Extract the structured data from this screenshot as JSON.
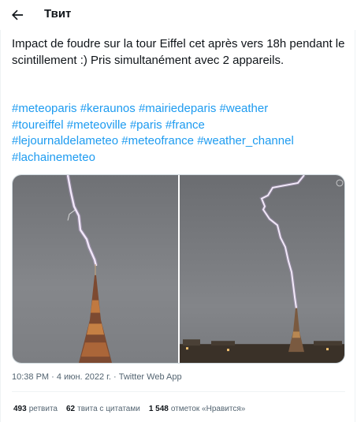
{
  "header": {
    "title": "Твит",
    "back_icon": "arrow-left-icon"
  },
  "tweet": {
    "text": "Impact de foudre sur la tour Eiffel cet après vers 18h pendant le scintillement :) Pris simultanément avec 2 appareils.",
    "hashtags": [
      "#meteoparis",
      "#keraunos",
      "#mairiedeparis",
      "#weather",
      "#toureiffel",
      "#meteoville",
      "#paris",
      "#france",
      "#lejournaldelameteo",
      "#meteofrance",
      "#weather_channel",
      "#lachainemeteo"
    ],
    "time": "10:38 PM",
    "date": "4 июн. 2022 г.",
    "source": "Twitter Web App",
    "separator": "·"
  },
  "stats": [
    {
      "count": "493",
      "label": "ретвита"
    },
    {
      "count": "62",
      "label": "твита с цитатами"
    },
    {
      "count": "1 548",
      "label": "отметок «Нравится»"
    }
  ],
  "colors": {
    "link": "#1d9bf0",
    "text": "#0f1419",
    "muted": "#536471",
    "sky": "#7a7c80"
  }
}
